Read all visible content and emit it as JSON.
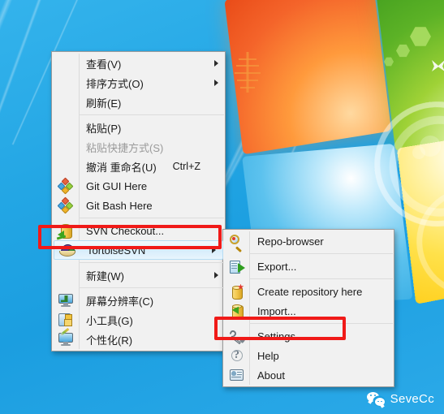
{
  "desktop": {
    "wallpaper_name": "windows-7-default-wallpaper",
    "background_color": "#1ba1e2"
  },
  "context_menu": {
    "name": "desktop-context-menu",
    "items": [
      {
        "label": "查看(V)",
        "icon": "",
        "submenu": true,
        "disabled": false,
        "shortcut": ""
      },
      {
        "label": "排序方式(O)",
        "icon": "",
        "submenu": true,
        "disabled": false,
        "shortcut": ""
      },
      {
        "label": "刷新(E)",
        "icon": "",
        "submenu": false,
        "disabled": false,
        "shortcut": ""
      },
      {
        "separator": true
      },
      {
        "label": "粘贴(P)",
        "icon": "",
        "submenu": false,
        "disabled": false,
        "shortcut": ""
      },
      {
        "label": "粘贴快捷方式(S)",
        "icon": "",
        "submenu": false,
        "disabled": true,
        "shortcut": ""
      },
      {
        "label": "撤消 重命名(U)",
        "icon": "",
        "submenu": false,
        "disabled": false,
        "shortcut": "Ctrl+Z"
      },
      {
        "label": "Git GUI Here",
        "icon": "git-icon",
        "submenu": false,
        "disabled": false,
        "shortcut": ""
      },
      {
        "label": "Git Bash Here",
        "icon": "git-icon",
        "submenu": false,
        "disabled": false,
        "shortcut": ""
      },
      {
        "separator": true
      },
      {
        "label": "SVN Checkout...",
        "icon": "svn-checkout-icon",
        "submenu": false,
        "disabled": false,
        "shortcut": ""
      },
      {
        "label": "TortoiseSVN",
        "icon": "tortoise-icon",
        "submenu": true,
        "disabled": false,
        "shortcut": "",
        "highlighted": true
      },
      {
        "separator": true
      },
      {
        "label": "新建(W)",
        "icon": "",
        "submenu": true,
        "disabled": false,
        "shortcut": ""
      },
      {
        "separator": true
      },
      {
        "label": "屏幕分辨率(C)",
        "icon": "monitor-resolution-icon",
        "submenu": false,
        "disabled": false,
        "shortcut": ""
      },
      {
        "label": "小工具(G)",
        "icon": "gadgets-icon",
        "submenu": false,
        "disabled": false,
        "shortcut": ""
      },
      {
        "label": "个性化(R)",
        "icon": "personalize-icon",
        "submenu": false,
        "disabled": false,
        "shortcut": ""
      }
    ]
  },
  "submenu": {
    "name": "tortoisesvn-submenu",
    "items": [
      {
        "label": "Repo-browser",
        "icon": "repo-browser-icon",
        "disabled": false
      },
      {
        "separator": true
      },
      {
        "label": "Export...",
        "icon": "export-icon",
        "disabled": false
      },
      {
        "separator": true
      },
      {
        "label": "Create repository here",
        "icon": "create-repository-icon",
        "disabled": false
      },
      {
        "label": "Import...",
        "icon": "import-icon",
        "disabled": false
      },
      {
        "separator": true
      },
      {
        "label": "Settings",
        "icon": "settings-wrench-icon",
        "disabled": false,
        "annotated": true
      },
      {
        "label": "Help",
        "icon": "help-icon",
        "disabled": false
      },
      {
        "label": "About",
        "icon": "about-icon",
        "disabled": false
      }
    ]
  },
  "annotations": {
    "color": "#f01a18",
    "boxes": [
      {
        "target": "TortoiseSVN"
      },
      {
        "target": "Settings"
      }
    ]
  },
  "watermark": {
    "icon": "wechat-icon",
    "text": "SeveCc",
    "color": "#ffffff"
  }
}
